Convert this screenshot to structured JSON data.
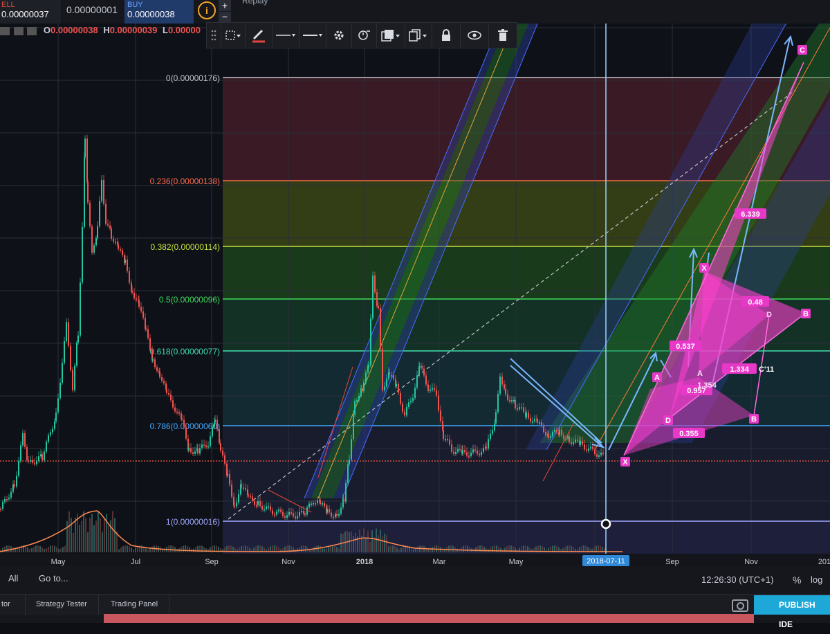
{
  "topbar": {
    "sell_label": "ELL",
    "sell_value": "0.00000037",
    "spread": "0.00000001",
    "buy_label": "BUY",
    "buy_value": "0.00000038",
    "info_icon": "i",
    "zoom_in": "+",
    "zoom_out": "−",
    "replay": "Replay"
  },
  "ohlc": {
    "o_key": "O",
    "o_val": "0.00000038",
    "h_key": "H",
    "h_val": "0.00000039",
    "l_key": "L",
    "l_val": "0.00000"
  },
  "toolbar": {
    "icons": [
      "drag-handle-icon",
      "select-area-icon",
      "pencil-icon",
      "line-style-icon",
      "line-width-icon",
      "gear-icon",
      "alert-icon",
      "stack-icon",
      "clone-icon",
      "lock-icon",
      "eye-icon",
      "trash-icon"
    ]
  },
  "chart": {
    "fib_levels": [
      {
        "label": "0(0.00000176)",
        "color": "#b9bcc4"
      },
      {
        "label": "0.236(0.00000138)",
        "color": "#ff6a4d"
      },
      {
        "label": "0.382(0.00000114)",
        "color": "#c6e03a"
      },
      {
        "label": "0.5(0.00000096)",
        "color": "#3edc5a"
      },
      {
        "label": "0.618(0.00000077)",
        "color": "#3fe0b0"
      },
      {
        "label": "0.786(0.00000060)",
        "color": "#44aaff"
      },
      {
        "label": "1(0.00000016)",
        "color": "#9fa7ff"
      }
    ],
    "x_ticks": [
      "May",
      "Jul",
      "Sep",
      "Nov",
      "2018",
      "Mar",
      "May",
      "Sep",
      "Nov",
      "201"
    ],
    "cursor_date": "2018-07-11",
    "pattern_labels": {
      "x1": "X",
      "a1": "A",
      "d1": "D",
      "b1": "B",
      "c1": "C",
      "x2": "X",
      "b2": "B",
      "d2": "D",
      "a2": "A",
      "r0355": "0.355",
      "r0957": "0.957",
      "r1354": "1.354",
      "r1334": "1.334",
      "r0537": "0.537",
      "r048": "0.48",
      "r6339": "6.339",
      "c11": "C'11"
    }
  },
  "bottom": {
    "all": "All",
    "goto": "Go to...",
    "clock": "12:26:30 (UTC+1)",
    "percent": "%",
    "log": "log",
    "tabs": [
      "tor",
      "Strategy Tester",
      "Trading Panel"
    ],
    "publish": "PUBLISH IDE"
  }
}
